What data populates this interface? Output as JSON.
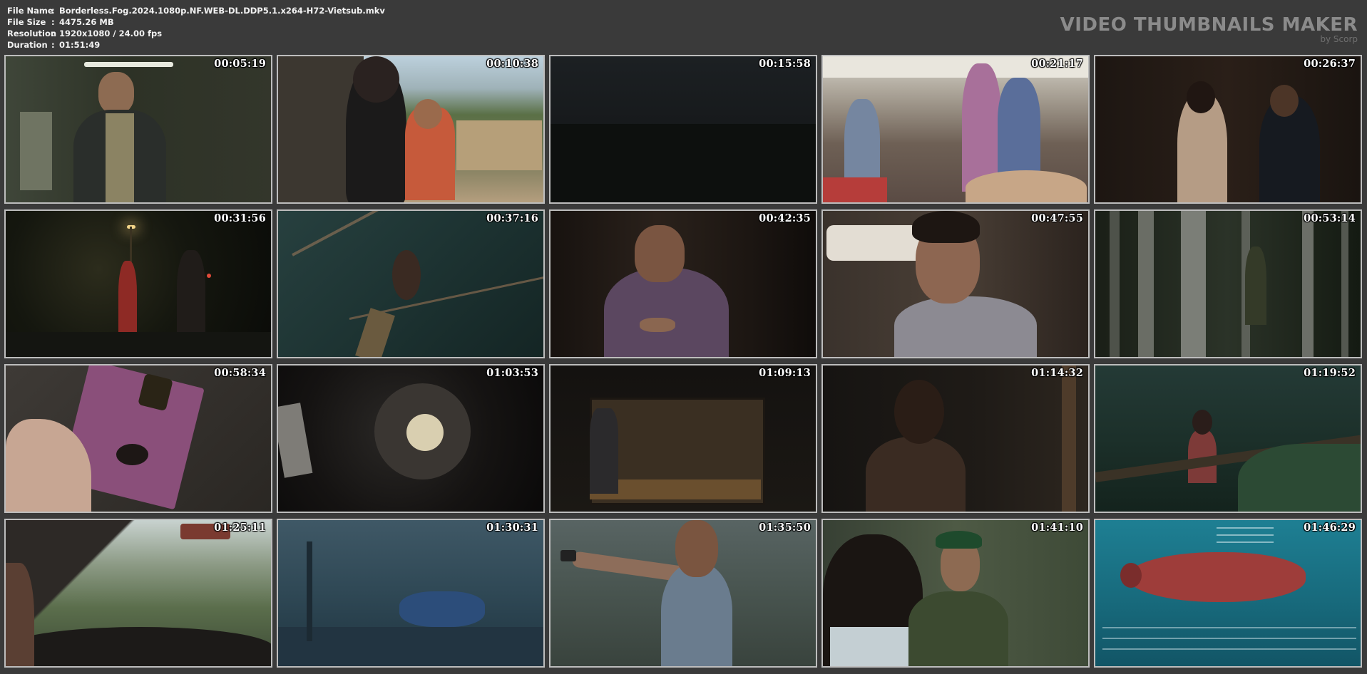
{
  "info": {
    "file_name_label": "File Name",
    "file_name": "Borderless.Fog.2024.1080p.NF.WEB-DL.DDP5.1.x264-H72-Vietsub.mkv",
    "file_size_label": "File Size",
    "file_size": "4475.26 MB",
    "resolution_label": "Resolution",
    "resolution": "1920x1080 / 24.00 fps",
    "duration_label": "Duration",
    "duration": "01:51:49",
    "separator": ":"
  },
  "brand": {
    "title": "VIDEO THUMBNAILS MAKER",
    "subtitle": "by Scorp"
  },
  "thumbnails": [
    {
      "timestamp": "00:05:19"
    },
    {
      "timestamp": "00:10:38"
    },
    {
      "timestamp": "00:15:58"
    },
    {
      "timestamp": "00:21:17"
    },
    {
      "timestamp": "00:26:37"
    },
    {
      "timestamp": "00:31:56"
    },
    {
      "timestamp": "00:37:16"
    },
    {
      "timestamp": "00:42:35"
    },
    {
      "timestamp": "00:47:55"
    },
    {
      "timestamp": "00:53:14"
    },
    {
      "timestamp": "00:58:34"
    },
    {
      "timestamp": "01:03:53"
    },
    {
      "timestamp": "01:09:13"
    },
    {
      "timestamp": "01:14:32"
    },
    {
      "timestamp": "01:19:52"
    },
    {
      "timestamp": "01:25:11"
    },
    {
      "timestamp": "01:30:31"
    },
    {
      "timestamp": "01:35:50"
    },
    {
      "timestamp": "01:41:10"
    },
    {
      "timestamp": "01:46:29"
    }
  ],
  "colors": {
    "background": "#3a3a3a",
    "frame_border": "#bdbdbd",
    "brand_text": "#8b8b8b"
  }
}
